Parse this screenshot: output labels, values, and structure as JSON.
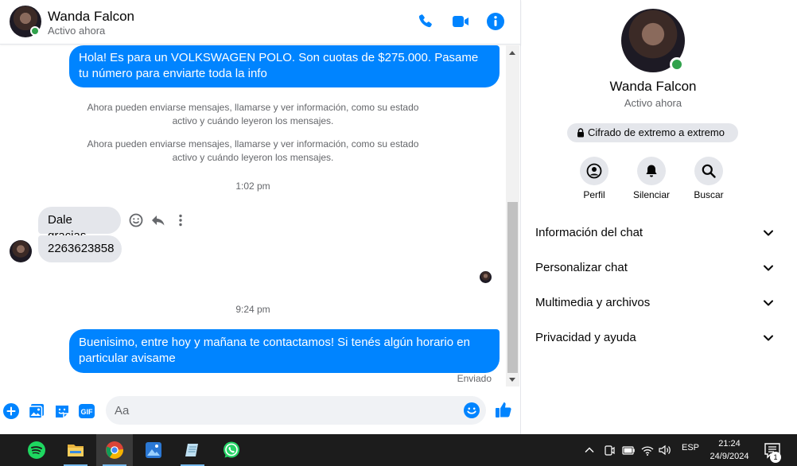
{
  "contact": {
    "name": "Wanda Falcon",
    "status": "Activo ahora"
  },
  "messages": {
    "m1": "Hola! Es para un VOLKSWAGEN POLO. Son cuotas de $275.000. Pasame tu número para enviarte toda la info",
    "sys1": "Ahora pueden enviarse mensajes, llamarse y ver información, como su estado activo y cuándo leyeron los mensajes.",
    "sys2": "Ahora pueden enviarse mensajes, llamarse y ver información, como su estado activo y cuándo leyeron los mensajes.",
    "time1": "1:02 pm",
    "m3": "Dale gracias",
    "m4": "2263623858",
    "time2": "9:24 pm",
    "m5": "Buenisimo, entre hoy y mañana te contactamos! Si tenés algún horario en particular avisame",
    "sent": "Enviado"
  },
  "composer": {
    "placeholder": "Aa",
    "gif_label": "GIF"
  },
  "panel": {
    "name": "Wanda Falcon",
    "status": "Activo ahora",
    "e2e": "Cifrado de extremo a extremo",
    "actions": [
      "Perfil",
      "Silenciar",
      "Buscar"
    ],
    "sections": [
      "Información del chat",
      "Personalizar chat",
      "Multimedia y archivos",
      "Privacidad y ayuda"
    ]
  },
  "taskbar": {
    "lang": "ESP",
    "time": "21:24",
    "date": "24/9/2024",
    "notif_count": "1"
  },
  "colors": {
    "accent": "#0084ff",
    "online": "#31a24c",
    "bubble_in": "#e4e6eb"
  }
}
